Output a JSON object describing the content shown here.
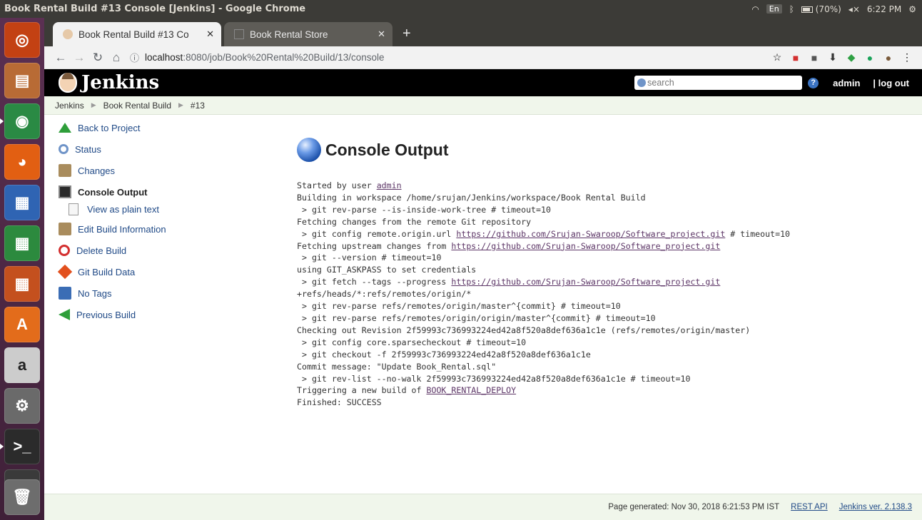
{
  "os": {
    "window_title": "Book Rental Build #13 Console [Jenkins] - Google Chrome",
    "keyboard": "En",
    "battery": "(70%)",
    "time": "6:22 PM",
    "launcher": [
      {
        "name": "ubuntu-dash-icon",
        "color": "#c34113",
        "glyph": "◎"
      },
      {
        "name": "files-icon",
        "color": "#b86b35",
        "glyph": "▤"
      },
      {
        "name": "chrome-icon",
        "color": "#2a8a44",
        "glyph": "◉",
        "active": true
      },
      {
        "name": "firefox-icon",
        "color": "#e25f12",
        "glyph": "◕"
      },
      {
        "name": "libreoffice-writer-icon",
        "color": "#2f64b3",
        "glyph": "▦"
      },
      {
        "name": "libreoffice-calc-icon",
        "color": "#2c8a3e",
        "glyph": "▦"
      },
      {
        "name": "libreoffice-impress-icon",
        "color": "#c4501e",
        "glyph": "▦"
      },
      {
        "name": "software-center-icon",
        "color": "#e36c1b",
        "glyph": "A"
      },
      {
        "name": "amazon-icon",
        "color": "#cccccc",
        "glyph": "a"
      },
      {
        "name": "settings-icon",
        "color": "#6a6a6a",
        "glyph": "⚙"
      },
      {
        "name": "terminal-icon",
        "color": "#2b2b2b",
        "glyph": ">_",
        "active": true
      },
      {
        "name": "sublime-text-icon",
        "color": "#3a3a3a",
        "glyph": "S"
      }
    ]
  },
  "browser": {
    "tabs": [
      {
        "title": "Book Rental Build #13 Co",
        "active": true
      },
      {
        "title": "Book Rental Store",
        "active": false
      }
    ],
    "url_host": "localhost",
    "url_rest": ":8080/job/Book%20Rental%20Build/13/console"
  },
  "jenkins": {
    "brand": "Jenkins",
    "search_placeholder": "search",
    "user": "admin",
    "logout": "| log out",
    "breadcrumbs": [
      "Jenkins",
      "Book Rental Build",
      "#13"
    ],
    "side_tasks": [
      {
        "name": "back-to-project",
        "label": "Back to Project",
        "icon": "arrow-up-icon",
        "color": "#2e9e3a"
      },
      {
        "name": "status",
        "label": "Status",
        "icon": "magnifier-icon",
        "color": "#6f94c8"
      },
      {
        "name": "changes",
        "label": "Changes",
        "icon": "notepad-icon",
        "color": "#a98c5d"
      },
      {
        "name": "console-output",
        "label": "Console Output",
        "icon": "terminal-icon",
        "color": "#2b2b2b",
        "current": true
      },
      {
        "name": "view-as-plain-text",
        "label": "View as plain text",
        "icon": "document-icon",
        "color": "#cccccc",
        "sub": true
      },
      {
        "name": "edit-build-information",
        "label": "Edit Build Information",
        "icon": "notepad-icon",
        "color": "#a98c5d"
      },
      {
        "name": "delete-build",
        "label": "Delete Build",
        "icon": "no-entry-icon",
        "color": "#d32f2f"
      },
      {
        "name": "git-build-data",
        "label": "Git Build Data",
        "icon": "git-icon",
        "color": "#e2501e"
      },
      {
        "name": "no-tags",
        "label": "No Tags",
        "icon": "floppy-icon",
        "color": "#3b6db5"
      },
      {
        "name": "previous-build",
        "label": "Previous Build",
        "icon": "arrow-left-icon",
        "color": "#2e9e3a"
      }
    ],
    "page_title": "Console Output",
    "console_lines": [
      [
        {
          "t": "Started by user "
        },
        {
          "t": "admin",
          "link": true
        }
      ],
      [
        {
          "t": "Building in workspace /home/srujan/Jenkins/workspace/Book Rental Build"
        }
      ],
      [
        {
          "t": " > git rev-parse --is-inside-work-tree # timeout=10"
        }
      ],
      [
        {
          "t": "Fetching changes from the remote Git repository"
        }
      ],
      [
        {
          "t": " > git config remote.origin.url "
        },
        {
          "t": "https://github.com/Srujan-Swaroop/Software_project.git",
          "link": true
        },
        {
          "t": " # timeout=10"
        }
      ],
      [
        {
          "t": "Fetching upstream changes from "
        },
        {
          "t": "https://github.com/Srujan-Swaroop/Software_project.git",
          "link": true
        }
      ],
      [
        {
          "t": " > git --version # timeout=10"
        }
      ],
      [
        {
          "t": "using GIT_ASKPASS to set credentials"
        }
      ],
      [
        {
          "t": " > git fetch --tags --progress "
        },
        {
          "t": "https://github.com/Srujan-Swaroop/Software_project.git",
          "link": true
        }
      ],
      [
        {
          "t": "+refs/heads/*:refs/remotes/origin/*"
        }
      ],
      [
        {
          "t": " > git rev-parse refs/remotes/origin/master^{commit} # timeout=10"
        }
      ],
      [
        {
          "t": " > git rev-parse refs/remotes/origin/origin/master^{commit} # timeout=10"
        }
      ],
      [
        {
          "t": "Checking out Revision 2f59993c736993224ed42a8f520a8def636a1c1e (refs/remotes/origin/master)"
        }
      ],
      [
        {
          "t": " > git config core.sparsecheckout # timeout=10"
        }
      ],
      [
        {
          "t": " > git checkout -f 2f59993c736993224ed42a8f520a8def636a1c1e"
        }
      ],
      [
        {
          "t": "Commit message: \"Update Book_Rental.sql\""
        }
      ],
      [
        {
          "t": " > git rev-list --no-walk 2f59993c736993224ed42a8f520a8def636a1c1e # timeout=10"
        }
      ],
      [
        {
          "t": "Triggering a new build of "
        },
        {
          "t": "BOOK_RENTAL_DEPLOY",
          "link": true
        }
      ],
      [
        {
          "t": "Finished: SUCCESS"
        }
      ]
    ],
    "footer": {
      "generated": "Page generated: Nov 30, 2018 6:21:53 PM IST",
      "rest_api": "REST API",
      "version": "Jenkins ver. 2.138.3"
    }
  }
}
